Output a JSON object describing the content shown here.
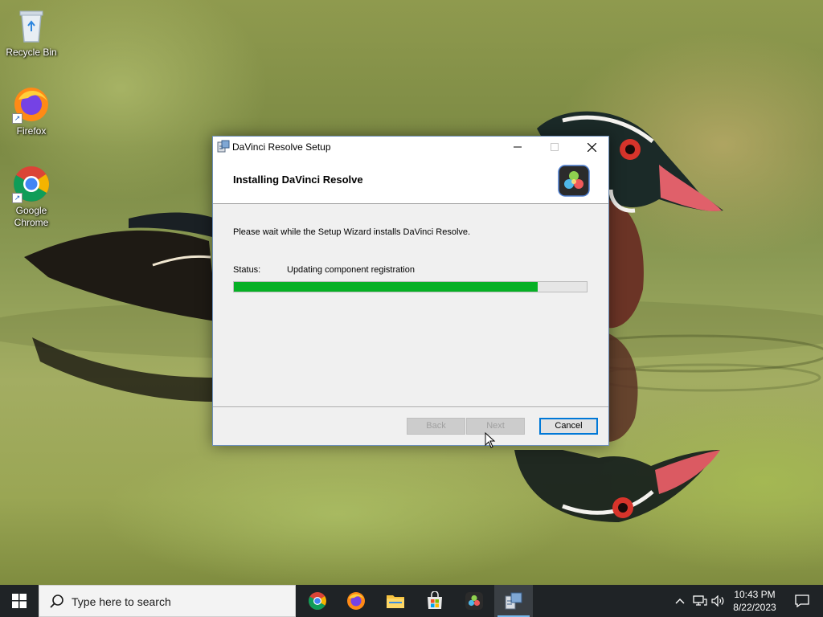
{
  "desktop": {
    "icons": [
      {
        "label": "Recycle Bin",
        "icon": "recycle-bin-icon"
      },
      {
        "label": "Firefox",
        "icon": "firefox-icon"
      },
      {
        "label": "Google Chrome",
        "icon": "chrome-icon"
      }
    ]
  },
  "installer": {
    "title": "DaVinci Resolve Setup",
    "heading": "Installing DaVinci Resolve",
    "description": "Please wait while the Setup Wizard installs DaVinci Resolve.",
    "status_label": "Status:",
    "status_value": "Updating component registration",
    "progress": 0.86,
    "buttons": {
      "back": "Back",
      "next": "Next",
      "cancel": "Cancel"
    },
    "controls": {
      "minimize": "—",
      "maximize": "☐",
      "close": "✕"
    }
  },
  "taskbar": {
    "search_placeholder": "Type here to search",
    "apps": [
      "chrome-icon",
      "firefox-icon",
      "file-explorer-icon",
      "microsoft-store-icon",
      "davinci-resolve-icon",
      "setup-installer-icon"
    ],
    "clock": {
      "time": "10:43 PM",
      "date": "8/22/2023"
    },
    "tray": {
      "chevron": "^",
      "volume": "🔊"
    }
  },
  "colors": {
    "progress_fill": "#06b025",
    "taskbar": "#1f2326",
    "accent": "#0078d7"
  }
}
